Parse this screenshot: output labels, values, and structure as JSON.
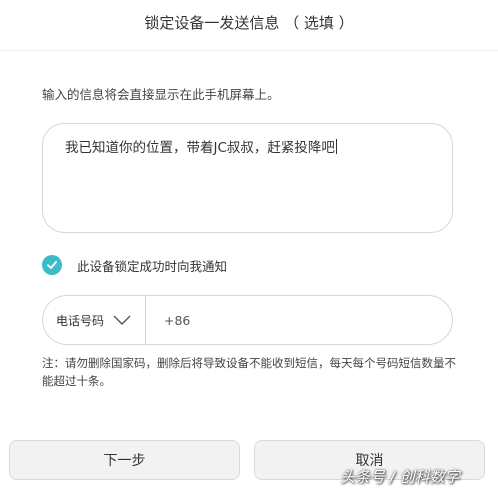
{
  "dialog": {
    "title": "锁定设备一发送信息 （ 选填 ）",
    "instruction": "输入的信息将会直接显示在此手机屏幕上。"
  },
  "message": {
    "value": "我已知道你的位置，带着JC叔叔，赶紧投降吧"
  },
  "notify": {
    "checked": true,
    "label": "此设备锁定成功时向我通知",
    "accent_color": "#3cbcc6"
  },
  "phone": {
    "type_label": "电话号码",
    "type_icon": "chevron-down-icon",
    "value": "+86"
  },
  "note": "注：请勿删除国家码，删除后将导致设备不能收到短信，每天每个号码短信数量不能超过十条。",
  "buttons": {
    "next": "下一步",
    "cancel": "取消"
  },
  "watermark": "头条号 / 创科数字"
}
